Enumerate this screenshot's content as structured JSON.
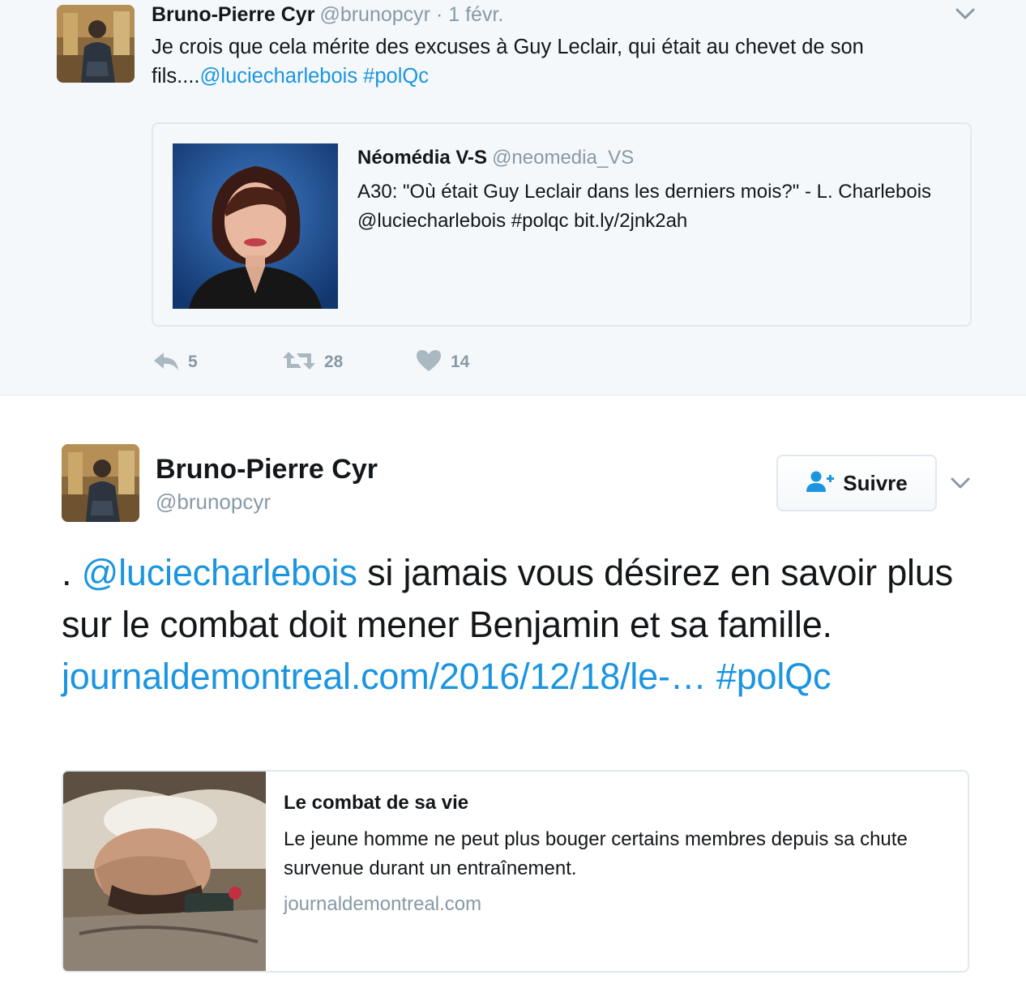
{
  "tweet1": {
    "author_name": "Bruno-Pierre Cyr",
    "author_handle": "@brunopcyr",
    "separator": "·",
    "date": "1 févr.",
    "text_plain": "Je crois que cela mérite des excuses à Guy Leclair, qui était au chevet de son fils....",
    "mention": "@luciecharlebois",
    "hashtag": "#polQc",
    "quote": {
      "author_name": "Néomédia V-S",
      "author_handle": "@neomedia_VS",
      "text": "A30: \"Où était Guy Leclair dans les derniers mois?\" - L. Charlebois @luciecharlebois #polqc bit.ly/2jnk2ah"
    },
    "actions": {
      "reply_count": "5",
      "retweet_count": "28",
      "like_count": "14"
    }
  },
  "tweet2": {
    "author_name": "Bruno-Pierre Cyr",
    "author_handle": "@brunopcyr",
    "follow_label": "Suivre",
    "text_prefix": ". ",
    "mention": "@luciecharlebois",
    "text_body": " si jamais vous désirez en savoir plus sur le combat doit mener Benjamin et sa famille.",
    "link": "journaldemontreal.com/2016/12/18/le-…",
    "hashtag": "#polQc",
    "card": {
      "title": "Le combat de sa vie",
      "description": "Le jeune homme ne peut plus bouger certains membres depuis sa chute survenue durant un entraînement.",
      "domain": "journaldemontreal.com"
    }
  },
  "colors": {
    "link": "#1b95e0",
    "muted": "#8899a6",
    "text": "#14171a",
    "border": "#e1e8ed",
    "background_gray": "#f5f8fa"
  }
}
